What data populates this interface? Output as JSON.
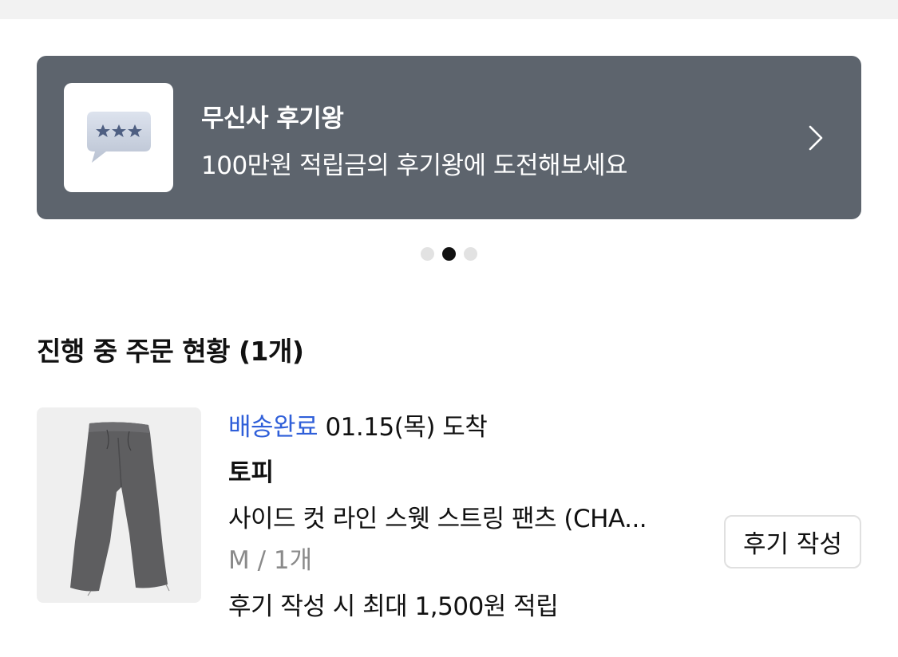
{
  "banner": {
    "title": "무신사 후기왕",
    "subtitle": "100만원 적립금의 후기왕에 도전해보세요",
    "icon": "speech-bubble-stars-icon",
    "background": "#5d646d"
  },
  "carousel": {
    "total": 3,
    "active_index": 1
  },
  "orders": {
    "section_title": "진행 중 주문 현황 (1개)",
    "items": [
      {
        "status": "배송완료",
        "arrival": "01.15(목) 도착",
        "brand": "토피",
        "product_name": "사이드 컷 라인 스웻 스트링 팬츠 (CHA...",
        "option": "M / 1개",
        "reward_note": "후기 작성 시 최대 1,500원 적립",
        "review_button": "후기 작성",
        "status_color": "#2f5fd9"
      }
    ]
  }
}
